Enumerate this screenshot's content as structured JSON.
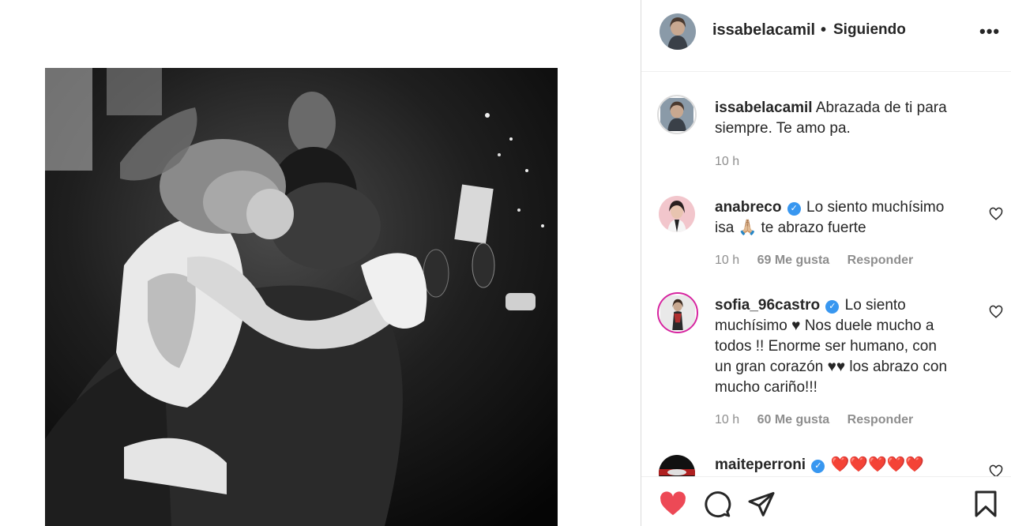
{
  "post": {
    "author": "issabelacamil",
    "dot": "•",
    "follow_status": "Siguiendo",
    "more_label": "•••"
  },
  "caption": {
    "username": "issabelacamil",
    "text": "Abrazada de ti para siempre. Te amo pa.",
    "time": "10 h"
  },
  "comments": [
    {
      "username": "anabreco",
      "verified": true,
      "text_line1": "Lo siento muchísimo",
      "text_line2_pre": "isa ",
      "emoji": "🙏🏼",
      "text_line2_post": " te abrazo fuerte",
      "time": "10 h",
      "likes": "69 Me gusta",
      "reply": "Responder"
    },
    {
      "username": "sofia_96castro",
      "verified": true,
      "text": "Lo siento muchísimo ♥ Nos duele mucho a todos !! Enorme ser humano, con un gran corazón ♥♥ los abrazo con mucho cariño!!!",
      "line1": "Lo siento",
      "line2": "muchísimo ♥ Nos duele mucho a",
      "line3": "todos !! Enorme ser humano, con",
      "line4": "un gran corazón ♥♥ los abrazo con",
      "line5": "mucho cariño!!!",
      "time": "10 h",
      "likes": "60 Me gusta",
      "reply": "Responder"
    },
    {
      "username": "maiteperroni",
      "verified": true,
      "text": "❤️❤️❤️❤️❤️"
    }
  ],
  "icons": {
    "more": "more-icon",
    "like": "heart-icon",
    "comment": "comment-icon",
    "share": "share-icon",
    "save": "bookmark-icon",
    "verified": "verified-icon"
  },
  "colors": {
    "like_red": "#ed4956",
    "verified_blue": "#3897f0",
    "muted": "#8e8e8e",
    "text": "#262626"
  }
}
